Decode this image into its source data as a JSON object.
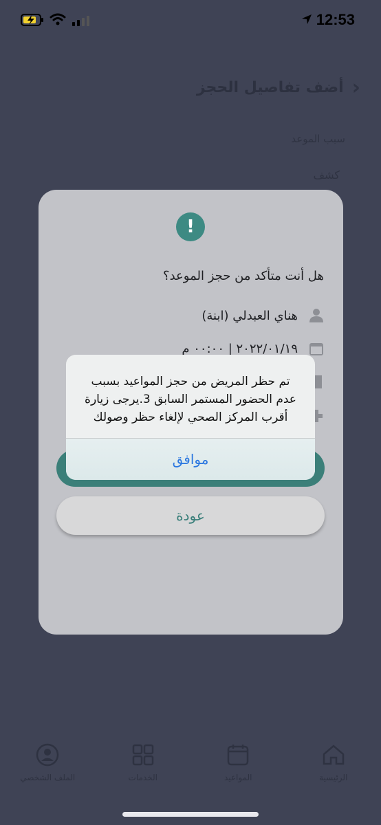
{
  "status_bar": {
    "time": "12:53"
  },
  "background_page": {
    "title": "أضف تفاصيل الحجز",
    "reason_label": "سبب الموعد",
    "reason_value": "كشف"
  },
  "dialog": {
    "question": "هل أنت متأكد من حجز الموعد؟",
    "patient_name": "هناي العبدلي (ابنة)",
    "datetime": "٢٠٢٢/٠١/١٩ | ٠٠:٠٠ م",
    "back_button": "عودة"
  },
  "ios_alert": {
    "message": "تم حظر المريض من حجز المواعيد بسبب عدم الحضور المستمر السابق 3.يرجى زيارة أقرب المركز الصحي لإلغاء حظر وصولك",
    "ok_button": "موافق"
  },
  "bottom_nav": {
    "items": [
      {
        "label": "الرئيسية",
        "icon": "home-icon"
      },
      {
        "label": "المواعيد",
        "icon": "calendar-icon"
      },
      {
        "label": "الخدمات",
        "icon": "grid-icon"
      },
      {
        "label": "الملف الشخصي",
        "icon": "profile-icon"
      }
    ]
  },
  "colors": {
    "overlay_bg": "#3f4355",
    "dialog_bg": "#c2c3c8",
    "accent_teal": "#3b7f79",
    "ios_blue": "#2b77e0"
  }
}
